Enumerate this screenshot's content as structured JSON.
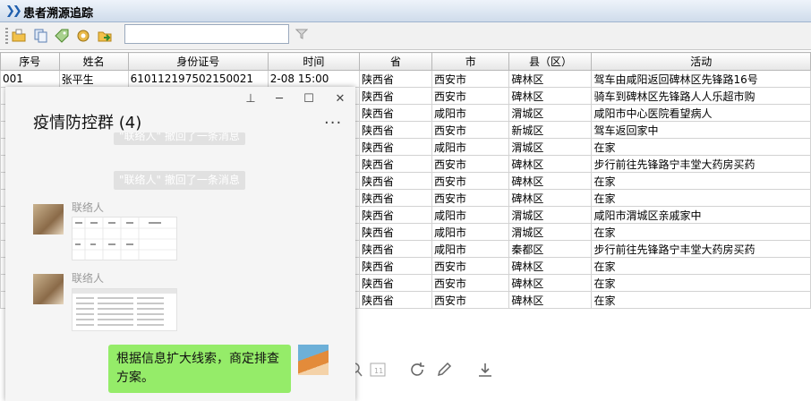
{
  "app": {
    "title": "患者溯源追踪"
  },
  "toolbar": {
    "search_value": "",
    "search_placeholder": ""
  },
  "table": {
    "columns": [
      "序号",
      "姓名",
      "身份证号",
      "时间",
      "省",
      "市",
      "县（区）",
      "活动"
    ],
    "rows": [
      [
        "001",
        "张平生",
        "610112197502150021",
        "2-08 15:00",
        "陕西省",
        "西安市",
        "碑林区",
        "驾车由咸阳返回碑林区先锋路16号"
      ],
      [
        "",
        "",
        "",
        "",
        "陕西省",
        "西安市",
        "碑林区",
        "骑车到碑林区先锋路人人乐超市购"
      ],
      [
        "",
        "",
        "",
        "",
        "陕西省",
        "咸阳市",
        "渭城区",
        "咸阳市中心医院看望病人"
      ],
      [
        "",
        "",
        "",
        "",
        "陕西省",
        "西安市",
        "新城区",
        "驾车返回家中"
      ],
      [
        "",
        "",
        "",
        "",
        "陕西省",
        "咸阳市",
        "渭城区",
        "在家"
      ],
      [
        "",
        "",
        "",
        "",
        "陕西省",
        "西安市",
        "碑林区",
        "步行前往先锋路宁丰堂大药房买药"
      ],
      [
        "",
        "",
        "",
        "",
        "陕西省",
        "西安市",
        "碑林区",
        "在家"
      ],
      [
        "",
        "",
        "",
        "",
        "陕西省",
        "西安市",
        "碑林区",
        "在家"
      ],
      [
        "",
        "",
        "",
        "",
        "陕西省",
        "咸阳市",
        "渭城区",
        "咸阳市渭城区亲戚家中"
      ],
      [
        "",
        "",
        "",
        "",
        "陕西省",
        "咸阳市",
        "渭城区",
        "在家"
      ],
      [
        "",
        "",
        "",
        "",
        "陕西省",
        "咸阳市",
        "秦都区",
        "步行前往先锋路宁丰堂大药房买药"
      ],
      [
        "",
        "",
        "",
        "",
        "陕西省",
        "西安市",
        "碑林区",
        "在家"
      ],
      [
        "",
        "",
        "",
        "",
        "陕西省",
        "西安市",
        "碑林区",
        "在家"
      ],
      [
        "",
        "",
        "",
        "",
        "陕西省",
        "西安市",
        "碑林区",
        "在家"
      ]
    ]
  },
  "chat": {
    "group_name": "疫情防控群 (4)",
    "more": "···",
    "recall_partial": "\"联络人\" 撤回了一条消息",
    "recall": "\"联络人\" 撤回了一条消息",
    "sender1": "联络人",
    "sender2": "联络人",
    "my_message": "根据信息扩大线索，商定排查方案。"
  },
  "colors": {
    "bubble": "#95ec69",
    "title_accent": "#1f5fae"
  },
  "icons": [
    "open-folder-icon",
    "copy-icon",
    "tag-icon",
    "settings-icon",
    "export-icon",
    "filter-icon",
    "pin-icon",
    "minimize-icon",
    "maximize-icon",
    "close-icon",
    "rotate-icon",
    "edit-icon",
    "download-icon"
  ]
}
